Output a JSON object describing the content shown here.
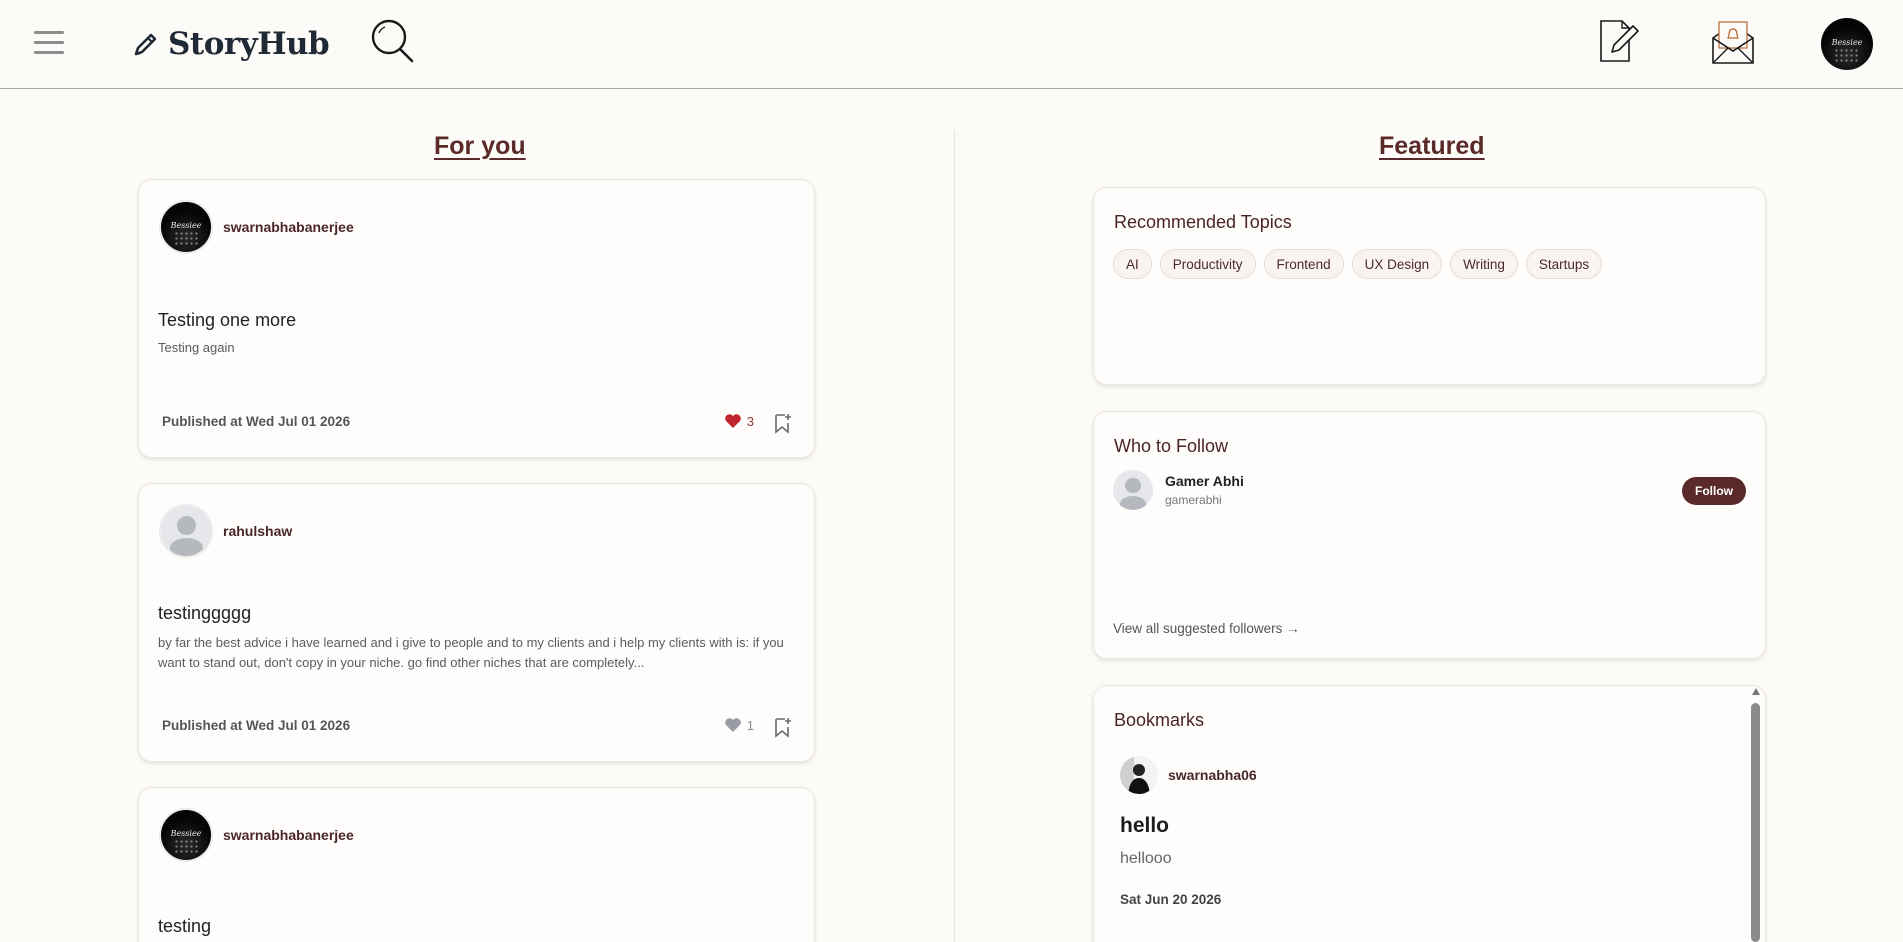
{
  "header": {
    "logo_text": "StoryHub",
    "icons": [
      "menu-icon",
      "pen-logo-icon",
      "search-icon",
      "write-icon",
      "notification-mail-icon"
    ]
  },
  "avatar_script": "Bessiee",
  "feed": {
    "title": "For you",
    "posts": [
      {
        "author": "swarnabhabanerjee",
        "title": "Testing one more",
        "excerpt": "Testing again",
        "published": "Published at Wed Jul 01 2026",
        "likes": "3",
        "liked": true
      },
      {
        "author": "rahulshaw",
        "title": "testinggggg",
        "excerpt": "by far the best advice i have learned and i give to people and to my clients and i help my clients with is: if you want to stand out, don't copy in your niche. go find other niches that are completely...",
        "published": "Published at Wed Jul 01 2026",
        "likes": "1",
        "liked": false
      },
      {
        "author": "swarnabhabanerjee",
        "title": "testing"
      }
    ]
  },
  "featured": {
    "title": "Featured",
    "recommended": {
      "title": "Recommended Topics",
      "topics": [
        "AI",
        "Productivity",
        "Frontend",
        "UX Design",
        "Writing",
        "Startups"
      ]
    },
    "who_to_follow": {
      "title": "Who to Follow",
      "user_name": "Gamer Abhi",
      "user_handle": "gamerabhi",
      "follow_label": "Follow",
      "view_all": "View all suggested followers →"
    },
    "bookmarks": {
      "title": "Bookmarks",
      "author": "swarnabha06",
      "post_title": "hello",
      "excerpt": "hellooo",
      "date": "Sat Jun 20 2026"
    }
  },
  "colors": {
    "accent": "#5a2a2a",
    "liked_heart": "#c0262d",
    "unliked_heart": "#9a9ca3",
    "background": "#fdfbf8"
  }
}
